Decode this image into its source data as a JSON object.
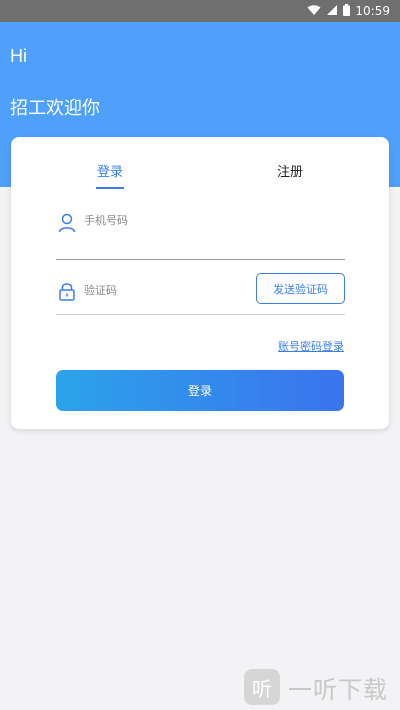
{
  "status_bar": {
    "time": "10:59"
  },
  "header": {
    "greeting": "Hi",
    "welcome": "招工欢迎你"
  },
  "tabs": {
    "login": "登录",
    "register": "注册"
  },
  "form": {
    "phone_placeholder": "手机号码",
    "code_placeholder": "验证码",
    "send_code": "发送验证码",
    "password_login": "账号密码登录",
    "submit": "登录"
  },
  "watermark": {
    "logo_glyph": "听",
    "text": "一听下载"
  },
  "colors": {
    "accent": "#3a7ee8",
    "header_bg": "#4ea0fb",
    "gradient_start": "#2ba3ea",
    "gradient_end": "#3b73ef"
  }
}
